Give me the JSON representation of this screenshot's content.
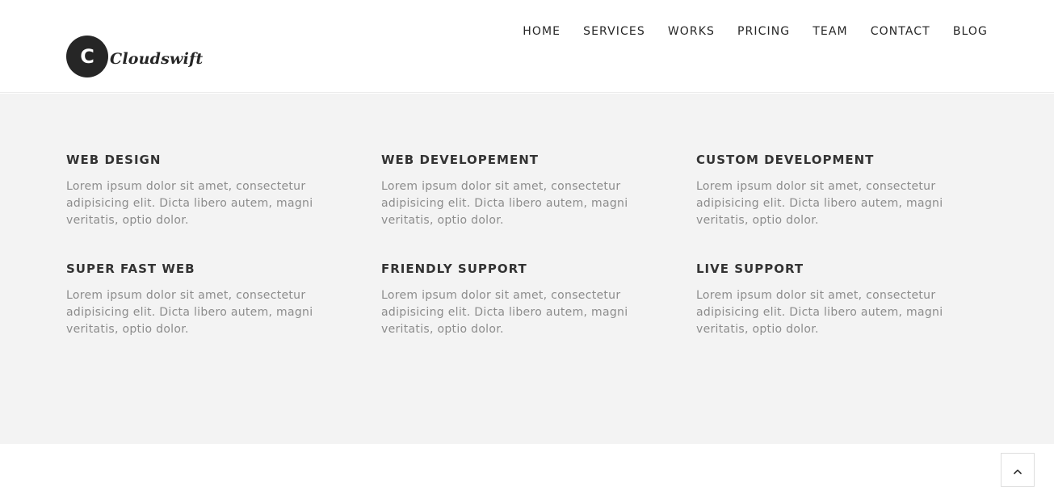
{
  "brand": {
    "logo_letter": "C",
    "logo_text": "Cloudswift"
  },
  "nav": {
    "items": [
      {
        "label": "HOME"
      },
      {
        "label": "SERVICES"
      },
      {
        "label": "WORKS"
      },
      {
        "label": "PRICING"
      },
      {
        "label": "TEAM"
      },
      {
        "label": "CONTACT"
      },
      {
        "label": "BLOG"
      }
    ]
  },
  "services": [
    {
      "title": "WEB DESIGN",
      "text": "Lorem ipsum dolor sit amet, consectetur adipisicing elit. Dicta libero autem, magni veritatis, optio dolor."
    },
    {
      "title": "WEB DEVELOPEMENT",
      "text": "Lorem ipsum dolor sit amet, consectetur adipisicing elit. Dicta libero autem, magni veritatis, optio dolor."
    },
    {
      "title": "CUSTOM DEVELOPMENT",
      "text": "Lorem ipsum dolor sit amet, consectetur adipisicing elit. Dicta libero autem, magni veritatis, optio dolor."
    },
    {
      "title": "SUPER FAST WEB",
      "text": "Lorem ipsum dolor sit amet, consectetur adipisicing elit. Dicta libero autem, magni veritatis, optio dolor."
    },
    {
      "title": "FRIENDLY SUPPORT",
      "text": "Lorem ipsum dolor sit amet, consectetur adipisicing elit. Dicta libero autem, magni veritatis, optio dolor."
    },
    {
      "title": "LIVE SUPPORT",
      "text": "Lorem ipsum dolor sit amet, consectetur adipisicing elit. Dicta libero autem, magni veritatis, optio dolor."
    }
  ],
  "back_to_top": {
    "icon": "chevron-up-icon"
  },
  "colors": {
    "section_bg": "#f3f3f3",
    "heading": "#333333",
    "body_text": "#8c8c8c",
    "logo_dark": "#262626"
  }
}
